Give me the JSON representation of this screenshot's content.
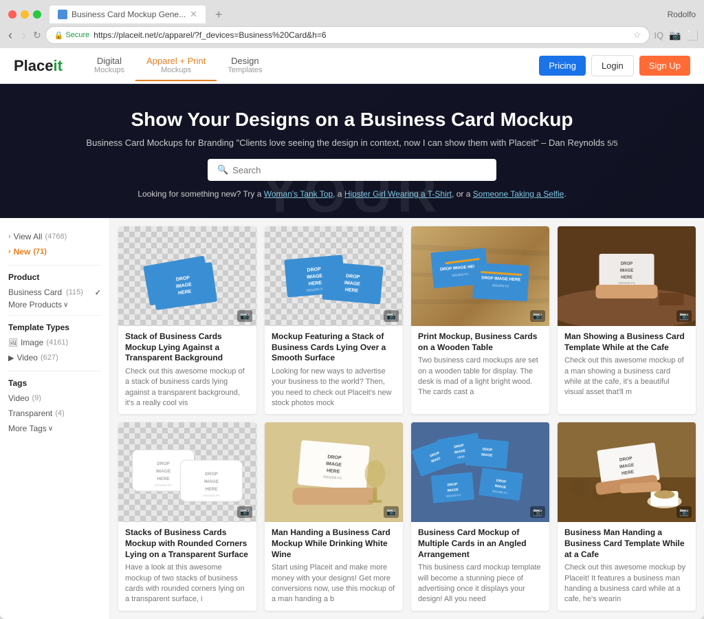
{
  "browser": {
    "tab_title": "Business Card Mockup Gene...",
    "url": "https://placeit.net/c/apparel/?f_devices=Business%20Card&h=6",
    "user_name": "Rodolfo",
    "nav_back_disabled": false,
    "nav_forward_disabled": true
  },
  "site": {
    "logo": "Placeit",
    "nav_items": [
      {
        "label": "Digital",
        "sub": "Mockups",
        "active": false
      },
      {
        "label": "Apparel + Print",
        "sub": "Mockups",
        "active": true
      },
      {
        "label": "Design",
        "sub": "Templates",
        "active": false
      }
    ],
    "nav_right": {
      "pricing": "Pricing",
      "login": "Login",
      "signup": "Sign Up"
    }
  },
  "hero": {
    "title": "Show Your Designs on a Business Card Mockup",
    "subtitle": "Business Card Mockups for Branding \"Clients love seeing the design in context, now I can show them with Placeit\" – Dan Reynolds",
    "subtitle_attribution": "5/5",
    "search_placeholder": "Search",
    "suggestion_prefix": "Looking for something new? Try a",
    "suggestions": [
      "Woman's Tank Top",
      "Hipster Girl Wearing a T-Shirt",
      "Someone Taking a Selfie"
    ],
    "bg_text": "YOUR"
  },
  "sidebar": {
    "view_all": "View All",
    "view_all_count": "(4768)",
    "new_label": "New",
    "new_count": "(71)",
    "product_section": "Product",
    "business_card": "Business Card",
    "business_card_count": "(115)",
    "more_products": "More Products",
    "template_types": "Template Types",
    "image_label": "Image",
    "image_count": "(4161)",
    "video_label": "Video",
    "video_count": "(627)",
    "tags_section": "Tags",
    "tag_video": "Video",
    "tag_video_count": "(9)",
    "tag_transparent": "Transparent",
    "tag_transparent_count": "(4)",
    "more_tags": "More Tags"
  },
  "grid": {
    "row1": [
      {
        "title": "Stack of Business Cards Mockup Lying Against a Transparent Background",
        "desc": "Check out this awesome mockup of a stack of business cards lying against a transparent background, it's a really cool vis",
        "bg_type": "checkerboard"
      },
      {
        "title": "Mockup Featuring a Stack of Business Cards Lying Over a Smooth Surface",
        "desc": "Looking for new ways to advertise your business to the world? Then, you need to check out Placeit's new stock photos mock",
        "bg_type": "checkerboard"
      },
      {
        "title": "Print Mockup, Business Cards on a Wooden Table",
        "desc": "Two business card mockups are set on a wooden table for display. The desk is mad of a light bright wood. The cards cast a",
        "bg_type": "wood"
      },
      {
        "title": "Man Showing a Business Card Template While at the Cafe",
        "desc": "Check out this awesome mockup of a man showing a business card while at the cafe, it's a beautiful visual asset that'll m",
        "bg_type": "cafe"
      }
    ],
    "row2": [
      {
        "title": "Stacks of Business Cards Mockup with Rounded Corners Lying on a Transparent Surface",
        "desc": "Have a look at this awesome mockup of two stacks of business cards with rounded corners lying on a transparent surface, i",
        "bg_type": "checkerboard"
      },
      {
        "title": "Man Handing a Business Card Mockup While Drinking White Wine",
        "desc": "Start using Placeit and make more money with your designs! Get more conversions now, use this mockup of a man handing a b",
        "bg_type": "hand_wine"
      },
      {
        "title": "Business Card Mockup of Multiple Cards in an Angled Arrangement",
        "desc": "This business card mockup template will become a stunning piece of advertising once it displays your design! All you need",
        "bg_type": "multiple"
      },
      {
        "title": "Business Man Handing a Business Card Template While at a Cafe",
        "desc": "Check out this awesome mockup by Placeit! It features a business man handing a business card while at a cafe, he's wearin",
        "bg_type": "cafe2"
      }
    ]
  },
  "icons": {
    "camera": "📷",
    "check": "✓",
    "image_icon": "🖼",
    "video_icon": "▶"
  }
}
